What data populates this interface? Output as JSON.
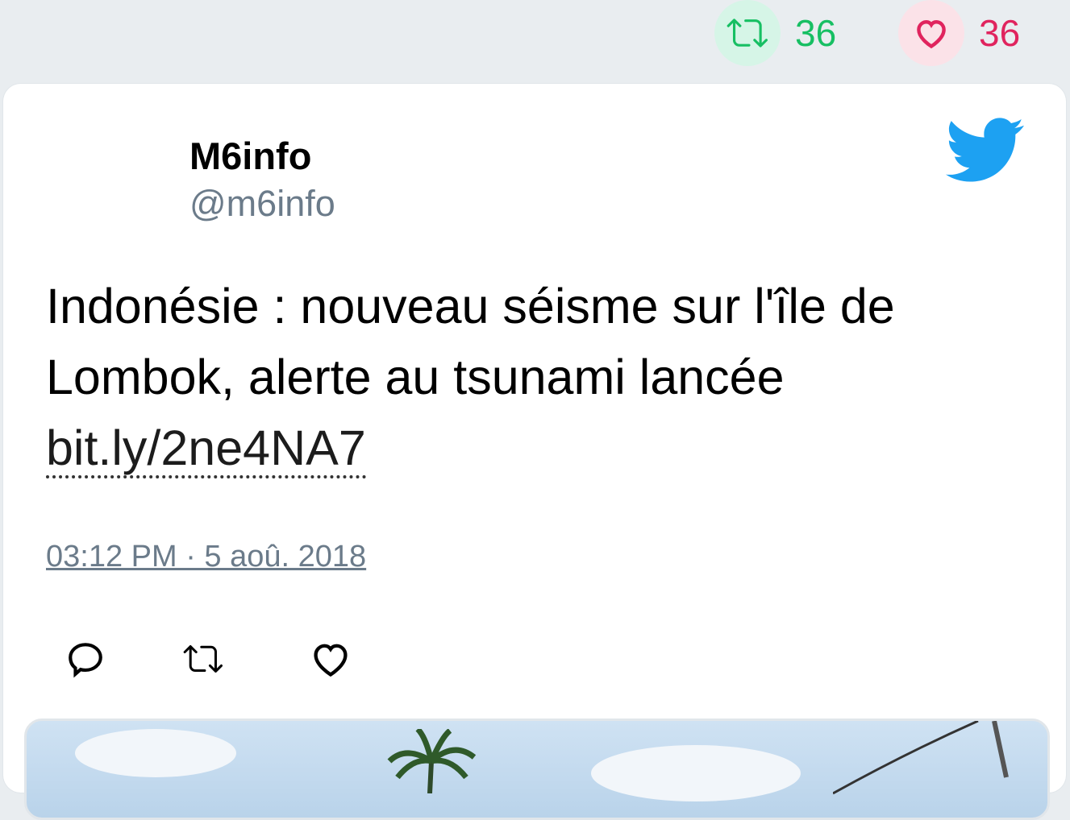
{
  "top_stats": {
    "retweet_count": "36",
    "like_count": "36",
    "retweet_icon": "retweet-icon",
    "like_icon": "heart-icon"
  },
  "tweet": {
    "author_name": "M6info",
    "author_handle": "@m6info",
    "text_line1": "Indonésie : nouveau séisme sur l'île de",
    "text_line2": "Lombok, alerte au tsunami lancée",
    "link": "bit.ly/2ne4NA7",
    "timestamp": "03:12 PM · 5 aoû. 2018",
    "brand_icon": "twitter-bird-icon"
  },
  "actions": [
    "reply-icon",
    "retweet-icon",
    "like-icon"
  ],
  "colors": {
    "background": "#e9edf0",
    "retweet_green": "#17bf63",
    "like_red": "#e0245e",
    "twitter_blue": "#1da1f2",
    "secondary_text": "#6b7b8a"
  }
}
